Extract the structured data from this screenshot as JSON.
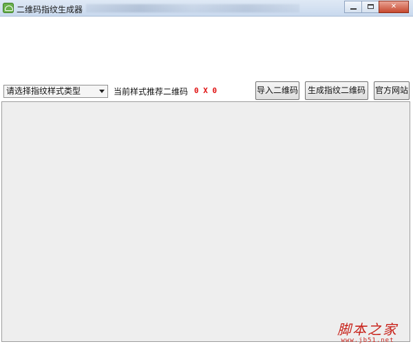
{
  "window": {
    "title": "二维码指纹生成器",
    "controls": {
      "minimize": "",
      "maximize": "",
      "close": "✕"
    }
  },
  "toolbar": {
    "style_select": {
      "value": "请选择指纹样式类型"
    },
    "recommend_label": "当前样式推荐二维码",
    "recommend_value": "0 X 0",
    "import_button": "导入二维码",
    "generate_button": "生成指纹二维码",
    "official_button": "官方网站"
  },
  "watermark": {
    "text": "脚本之家",
    "url": "www.jb51.net"
  },
  "colors": {
    "accent_red": "#e01010",
    "panel_bg": "#eeeeee",
    "titlebar": "#c9d9ee"
  }
}
